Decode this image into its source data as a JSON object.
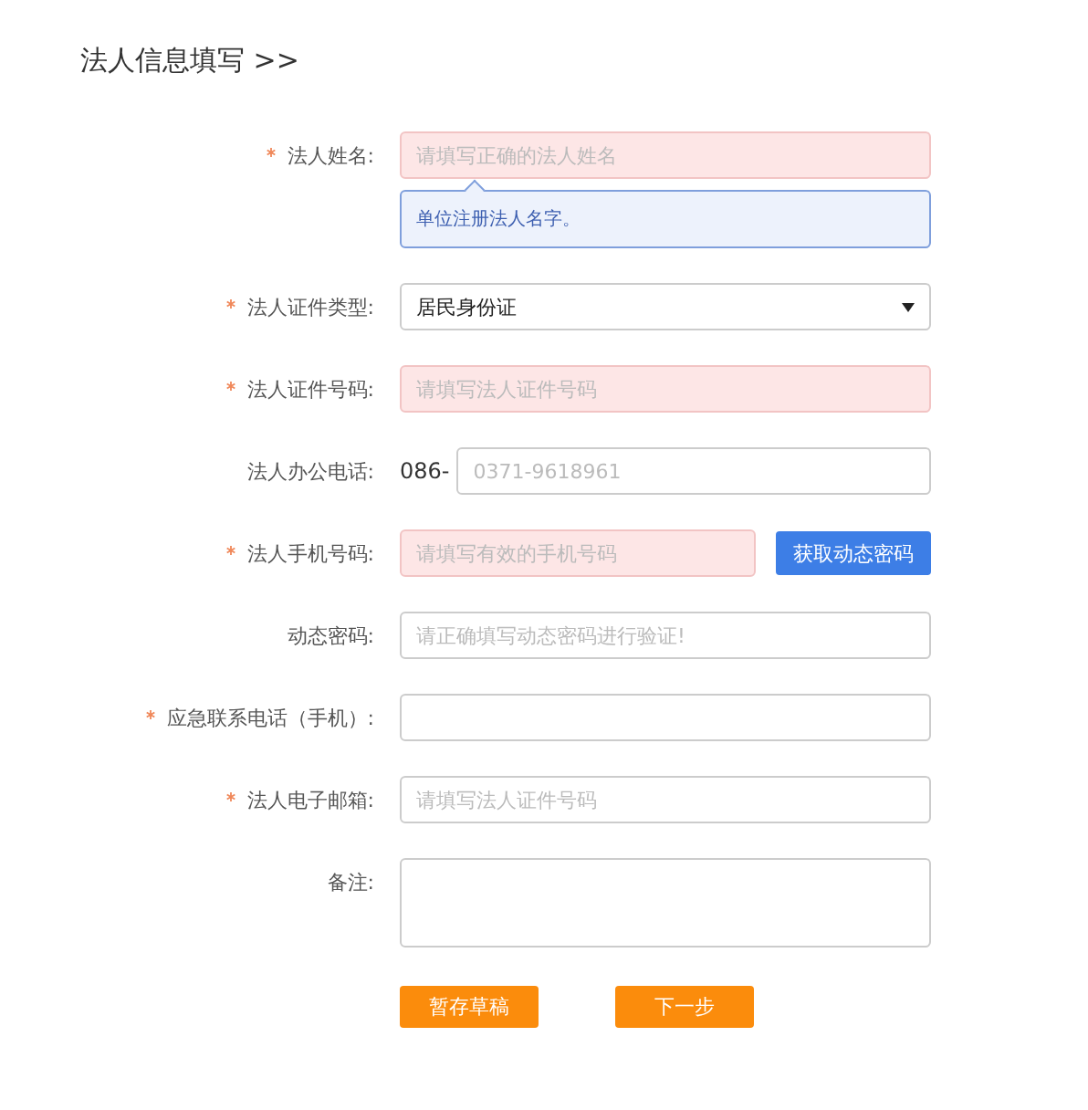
{
  "title": "法人信息填写 >>",
  "rows": [
    {
      "kind": "input",
      "required": true,
      "label": "法人姓名:",
      "placeholder": "请填写正确的法人姓名",
      "invalid": true,
      "hint": "单位注册法人名字。"
    },
    {
      "kind": "select",
      "required": true,
      "label": "法人证件类型:",
      "value": "居民身份证"
    },
    {
      "kind": "input",
      "required": true,
      "label": "法人证件号码:",
      "placeholder": "请填写法人证件号码",
      "invalid": true
    },
    {
      "kind": "prefixed",
      "required": false,
      "label": "法人办公电话:",
      "prefix": "086-",
      "placeholder": "0371-9618961",
      "invalid": false
    },
    {
      "kind": "with_button",
      "required": true,
      "label": "法人手机号码:",
      "placeholder": "请填写有效的手机号码",
      "invalid": true,
      "button": "获取动态密码"
    },
    {
      "kind": "input",
      "required": false,
      "label": "动态密码:",
      "placeholder": "请正确填写动态密码进行验证!",
      "invalid": false
    },
    {
      "kind": "input",
      "required": true,
      "label": "应急联系电话（手机）:",
      "invalid": false
    },
    {
      "kind": "input",
      "required": true,
      "label": "法人电子邮箱:",
      "placeholder": "请填写法人证件号码",
      "invalid": false
    },
    {
      "kind": "textarea",
      "required": false,
      "label": "备注:"
    }
  ],
  "buttons": [
    "暂存草稿",
    "下一步"
  ]
}
